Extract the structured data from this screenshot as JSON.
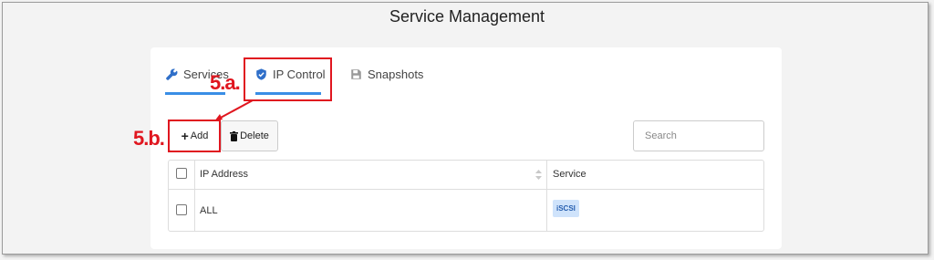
{
  "page": {
    "title": "Service Management"
  },
  "tabs": [
    {
      "label": "Services",
      "icon": "wrench-icon"
    },
    {
      "label": "IP Control",
      "icon": "shield-check-icon"
    },
    {
      "label": "Snapshots",
      "icon": "save-icon"
    }
  ],
  "toolbar": {
    "add_label": "Add",
    "delete_label": "Delete"
  },
  "search": {
    "placeholder": "Search"
  },
  "table": {
    "headers": [
      "IP Address",
      "Service"
    ],
    "rows": [
      {
        "ip": "ALL",
        "service": "iSCSI"
      }
    ]
  },
  "annotations": {
    "step_a": "5.a.",
    "step_b": "5.b."
  },
  "colors": {
    "accent": "#3a8ee6",
    "annotation": "#e0161f",
    "badge_bg": "#cfe3fb"
  }
}
